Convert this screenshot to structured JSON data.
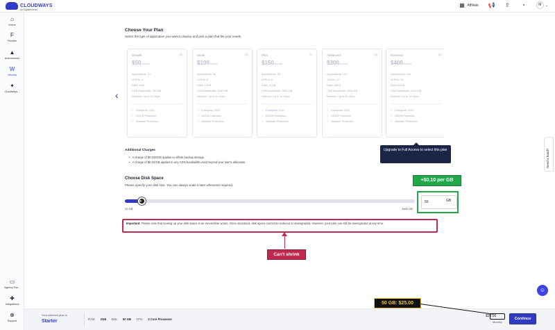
{
  "topbar": {
    "logo_text": "CLOUDWAYS",
    "logo_sub": "by DigitalOcean",
    "affiliate_label": "Affiliate",
    "avatar_initial": "M"
  },
  "sidebar": {
    "items": [
      {
        "label": "Home",
        "icon": "home-icon"
      },
      {
        "label": "Flexible",
        "icon": "flexible-icon"
      },
      {
        "label": "Autonomous",
        "icon": "autonomous-icon"
      },
      {
        "label": "Velocity",
        "icon": "velocity-icon"
      },
      {
        "label": "Cloudways...",
        "icon": "cloudways-icon"
      }
    ],
    "bottom_items": [
      {
        "label": "Agency Par...",
        "icon": "agency-icon"
      },
      {
        "label": "Integrations",
        "icon": "integrations-icon"
      },
      {
        "label": "Support",
        "icon": "support-icon"
      }
    ]
  },
  "plan_section": {
    "title": "Choose Your Plan",
    "subtitle": "Select the type of application you want to deploy and pick a plan that fits your needs"
  },
  "plans": [
    {
      "name": "Growth",
      "price": "$50",
      "per": "/month",
      "apps": "Applications: 14",
      "vcpu": "vCPUs: 4",
      "ram": "RAM: 8GB",
      "cdn": "CDN Bandwidth: 700 GB",
      "network": "Network: Up to 10 Gbps"
    },
    {
      "name": "Scale",
      "price": "$100",
      "per": "/month",
      "apps": "Applications: 30",
      "vcpu": "vCPUs: 8",
      "ram": "RAM: 16GB",
      "cdn": "CDN Bandwidth: 1200 GB",
      "network": "Network: Up to 10 Gbps"
    },
    {
      "name": "Plus",
      "price": "$150",
      "per": "/month",
      "apps": "Applications: 38",
      "vcpu": "vCPUs: 8",
      "ram": "RAM: 32GB",
      "cdn": "CDN Bandwidth: 1500 GB",
      "network": "Network: Up to 10 Gbps"
    },
    {
      "name": "Advanced",
      "price": "$300",
      "per": "/month",
      "apps": "Applications: 100",
      "vcpu": "vCPUs: 12",
      "ram": "RAM: 48GB",
      "cdn": "CDN Bandwidth: 3000 GB",
      "network": "Network: Up to 10 Gbps"
    },
    {
      "name": "Business",
      "price": "$400",
      "per": "/month",
      "apps": "Applications: 150",
      "vcpu": "vCPUs: 16",
      "ram": "RAM: 64GB",
      "cdn": "CDN Bandwidth: 4000 GB",
      "network": "Network: Up to 10 Gbps"
    }
  ],
  "plan_features": [
    "Enterprise CDN",
    "DDOS Protection",
    "Malware Protection"
  ],
  "tooltip": "Upgrade to Full Access to select this plan",
  "additional": {
    "title": "Additional Charges",
    "items": [
      "A charge of $0.033/GB applies to offsite backup storage.",
      "A charge of $0.02/GB applies to any CDN bandwidth used beyond your plan's allocation."
    ]
  },
  "disk": {
    "title": "Choose Disk Space",
    "subtitle": "Please specify your disk size. You can always scale it later whenever required.",
    "min_label": "10 GB",
    "max_label": "1000 GB",
    "value": "50",
    "unit": "GB",
    "callout": "+$0.10 per GB"
  },
  "important": {
    "label": "Important:",
    "text": " Please note that scaling up your disk space is an irreversible action. Once increased, disk space cannot be reduced or downgraded. However, your plan can still be downgraded at any time."
  },
  "shrink_callout": "Can't shrink",
  "need_hand": "Need a hand?",
  "bottom": {
    "selected_label": "Your selected plan is",
    "selected_plan": "Starter",
    "ram_label": "RAM:",
    "ram_value": "2GB",
    "disk_label": "Disk:",
    "disk_value": "50 GB",
    "cpu_label": "CPU:",
    "cpu_value": "2 Core Processor",
    "price": "$25.00",
    "period": "Monthly",
    "continue_label": "Continue",
    "price_callout": "50 GB: $25.00"
  }
}
